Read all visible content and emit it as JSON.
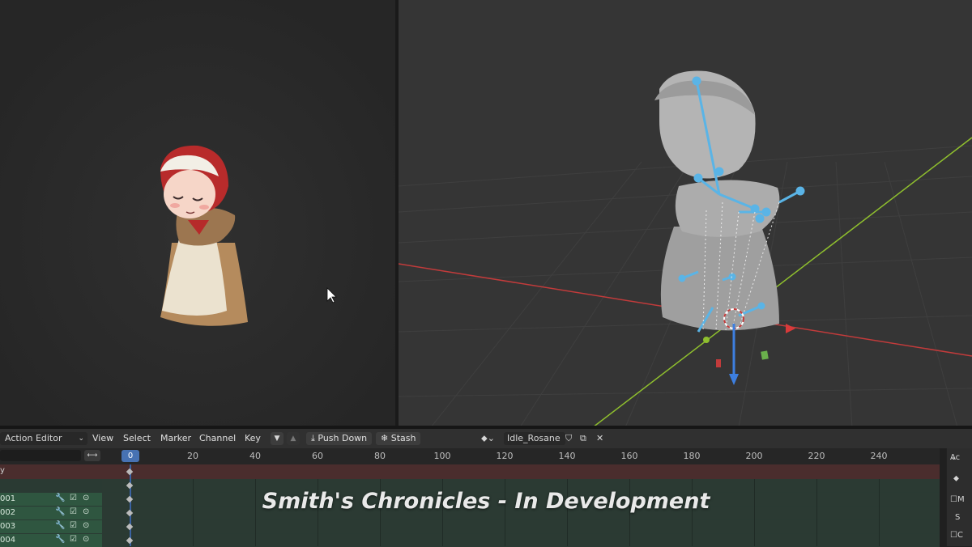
{
  "header": {
    "mode": "Action Editor",
    "menus": [
      "View",
      "Select",
      "Marker",
      "Channel",
      "Key"
    ],
    "push_down": "Push Down",
    "stash": "Stash",
    "action_name": "Idle_Rosane"
  },
  "timeline": {
    "current_frame": "0",
    "ticks": [
      "20",
      "40",
      "60",
      "80",
      "100",
      "120",
      "140",
      "160",
      "180",
      "200",
      "220",
      "240"
    ],
    "summary_label": "y",
    "rows": [
      "001",
      "002",
      "003",
      "004"
    ]
  },
  "side_panel": {
    "top": "Ac",
    "row1": "M",
    "row2": "S",
    "row3": "C"
  },
  "caption": "Smith's Chronicles - In Development",
  "colors": {
    "accent": "#4772b3",
    "bone": "#5ab4e6",
    "x_axis": "#c23b3b",
    "y_axis": "#8fbf2e"
  }
}
